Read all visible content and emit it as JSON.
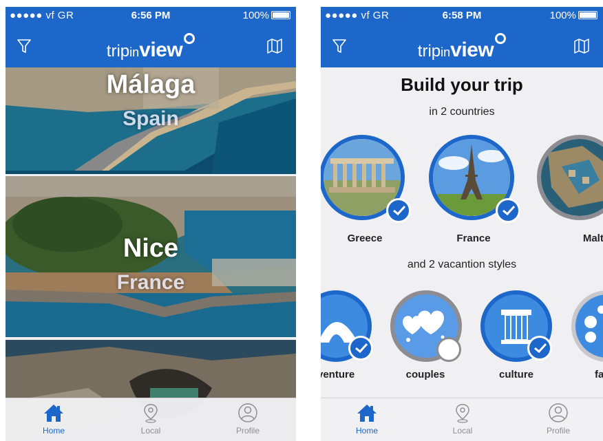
{
  "colors": {
    "brand": "#1c67c9",
    "tab_inactive": "#8e8e93"
  },
  "left_screen": {
    "status": {
      "carrier": "●●●●● vf GR",
      "time": "6:56 PM",
      "battery": "100%"
    },
    "logo": {
      "part1": "trip",
      "part2": "in",
      "part3": "view"
    },
    "nav_icons": {
      "left": "filter-icon",
      "right": "map-icon"
    },
    "cities": [
      {
        "city": "Málaga",
        "country": "Spain"
      },
      {
        "city": "Nice",
        "country": "France"
      },
      {
        "city": "",
        "country": ""
      }
    ],
    "tabs": [
      {
        "label": "Home",
        "icon": "home-icon",
        "active": true
      },
      {
        "label": "Local",
        "icon": "location-pin-icon",
        "active": false
      },
      {
        "label": "Profile",
        "icon": "profile-icon",
        "active": false
      }
    ]
  },
  "right_screen": {
    "status": {
      "carrier": "●●●●● vf GR",
      "time": "6:58 PM",
      "battery": "100%"
    },
    "logo": {
      "part1": "trip",
      "part2": "in",
      "part3": "view"
    },
    "heading": "Build your trip",
    "countries_caption": "in 2 countries",
    "countries": [
      {
        "name": "Greece",
        "selected": true
      },
      {
        "name": "France",
        "selected": true
      },
      {
        "name": "Malta",
        "selected": false
      }
    ],
    "styles_caption": "and 2 vacantion styles",
    "styles": [
      {
        "name": "adventure",
        "display": "lventure",
        "selected": true
      },
      {
        "name": "couples",
        "display": "couples",
        "selected": false
      },
      {
        "name": "culture",
        "display": "culture",
        "selected": true
      },
      {
        "name": "family",
        "display": "far",
        "selected": false
      }
    ],
    "tabs": [
      {
        "label": "Home",
        "icon": "home-icon",
        "active": true
      },
      {
        "label": "Local",
        "icon": "location-pin-icon",
        "active": false
      },
      {
        "label": "Profile",
        "icon": "profile-icon",
        "active": false
      }
    ]
  }
}
